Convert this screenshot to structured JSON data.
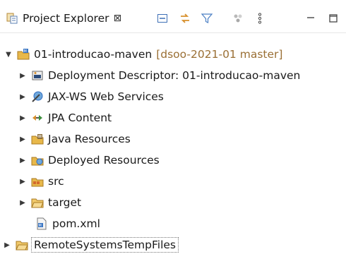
{
  "view": {
    "title": "Project Explorer",
    "close_glyph": "⊠"
  },
  "toolbar": {
    "icons": [
      "collapse-all-icon",
      "link-with-editor-icon",
      "filter-icon",
      "focus-icon",
      "view-menu-icon",
      "minimize-icon",
      "maximize-icon"
    ]
  },
  "tree": {
    "project": {
      "name": "01-introducao-maven",
      "decoration": "[dsoo-2021-01 master]"
    },
    "children": [
      {
        "label": "Deployment Descriptor: 01-introducao-maven",
        "icon": "deployment-descriptor-icon",
        "expandable": true
      },
      {
        "label": "JAX-WS Web Services",
        "icon": "web-services-icon",
        "expandable": true
      },
      {
        "label": "JPA Content",
        "icon": "jpa-content-icon",
        "expandable": true
      },
      {
        "label": "Java Resources",
        "icon": "java-resources-icon",
        "expandable": true
      },
      {
        "label": "Deployed Resources",
        "icon": "deployed-resources-icon",
        "expandable": true
      },
      {
        "label": "src",
        "icon": "source-folder-icon",
        "expandable": true
      },
      {
        "label": "target",
        "icon": "folder-icon",
        "expandable": true
      },
      {
        "label": "pom.xml",
        "icon": "maven-pom-icon",
        "expandable": false
      }
    ],
    "second_project": {
      "name": "RemoteSystemsTempFiles"
    }
  },
  "colors": {
    "decoration": "#9a6f34",
    "folder": "#e8b84a",
    "accent_blue": "#2e6bbf"
  }
}
